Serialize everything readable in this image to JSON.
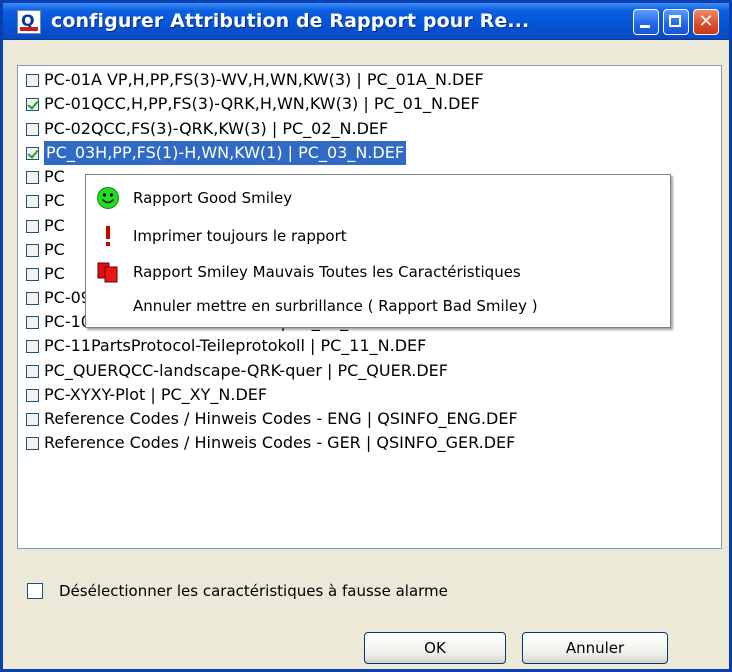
{
  "window": {
    "title": "configurer Attribution de Rapport pour Re...",
    "icon_letter": "Q"
  },
  "list": {
    "items": [
      {
        "label": "PC-01A VP,H,PP,FS(3)-WV,H,WN,KW(3) | PC_01A_N.DEF",
        "checked": false
      },
      {
        "label": "PC-01QCC,H,PP,FS(3)-QRK,H,WN,KW(3) | PC_01_N.DEF",
        "checked": true
      },
      {
        "label": "PC-02QCC,FS(3)-QRK,KW(3) | PC_02_N.DEF",
        "checked": false
      },
      {
        "label": "PC_03H,PP,FS(1)-H,WN,KW(1) | PC_03_N.DEF",
        "checked": true,
        "selected": true
      },
      {
        "label": "PC",
        "checked": false
      },
      {
        "label": "PC",
        "checked": false
      },
      {
        "label": "PC",
        "checked": false
      },
      {
        "label": "PC",
        "checked": false
      },
      {
        "label": "PC",
        "checked": false
      },
      {
        "label": "PC-09SummaryChar.Indiv.-Übers.EW | PC_09_N.DEF",
        "checked": false
      },
      {
        "label": "PC-10TestProc.SG-Testverf.SP | PC_10_N.DEF",
        "checked": false
      },
      {
        "label": "PC-11PartsProtocol-Teileprotokoll | PC_11_N.DEF",
        "checked": false
      },
      {
        "label": "PC_QUERQCC-landscape-QRK-quer | PC_QUER.DEF",
        "checked": false
      },
      {
        "label": "PC-XYXY-Plot | PC_XY_N.DEF",
        "checked": false
      },
      {
        "label": "Reference Codes / Hinweis Codes - ENG | QSINFO_ENG.DEF",
        "checked": false
      },
      {
        "label": "Reference Codes / Hinweis Codes - GER | QSINFO_GER.DEF",
        "checked": false
      }
    ]
  },
  "context_menu": {
    "items": [
      {
        "label": "Rapport Good Smiley",
        "icon": "smiley-icon"
      },
      {
        "label": "Imprimer toujours le rapport",
        "icon": "exclamation-icon"
      },
      {
        "label": "Rapport Smiley Mauvais Toutes les Caractéristiques",
        "icon": "red-pages-icon"
      },
      {
        "label": "Annuler mettre en surbrillance ( Rapport Bad Smiley )",
        "icon": ""
      }
    ]
  },
  "bottom": {
    "checkbox_label": "Désélectionner les caractéristiques à fausse alarme",
    "checked": false
  },
  "buttons": {
    "ok": "OK",
    "cancel": "Annuler"
  },
  "colors": {
    "title_bar": "#0454d6",
    "selection": "#316ac5",
    "face": "#ece9d8",
    "checkmark": "#21a121"
  }
}
